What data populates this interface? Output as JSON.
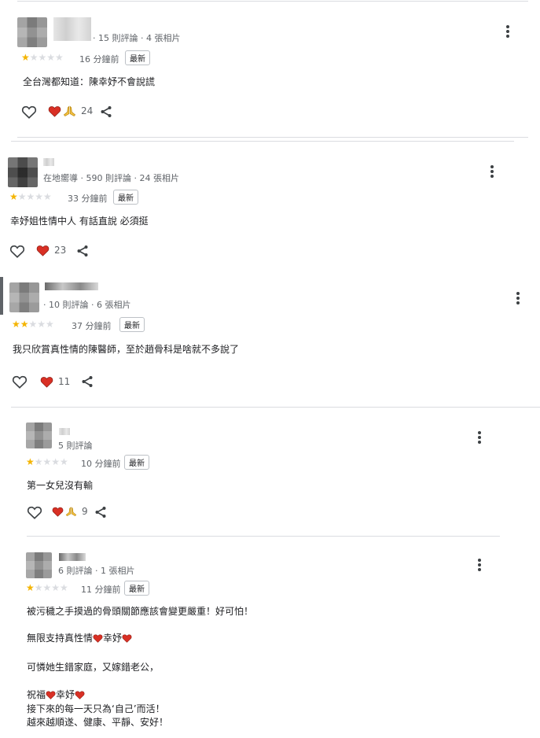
{
  "reviews": [
    {
      "meta": "· 15 則評論 · 4 張相片",
      "rating": 1,
      "time": "16 分鐘前",
      "badge": "最新",
      "lines": [
        "全台灣都知道：陳幸妤不會說謊"
      ],
      "reactions": [
        "heart",
        "pray"
      ],
      "count": "24"
    },
    {
      "meta": "在地嚮導 · 590 則評論 · 24 張相片",
      "rating": 1,
      "time": "33 分鐘前",
      "badge": "最新",
      "lines": [
        "幸妤姐性情中人 有話直說 必須挺"
      ],
      "reactions": [
        "heart"
      ],
      "count": "23"
    },
    {
      "meta": "· 10 則評論 · 6 張相片",
      "rating": 2,
      "time": "37 分鐘前",
      "badge": "最新",
      "lines": [
        "我只欣賞真性情的陳醫師，至於趙骨科是啥就不多說了"
      ],
      "reactions": [
        "heart"
      ],
      "count": "11"
    },
    {
      "meta": "5 則評論",
      "rating": 1,
      "time": "10 分鐘前",
      "badge": "最新",
      "lines": [
        "第一女兒沒有輸"
      ],
      "reactions": [
        "heart",
        "pray"
      ],
      "count": "9"
    },
    {
      "meta": "6 則評論 · 1 張相片",
      "rating": 1,
      "time": "11 分鐘前",
      "badge": "最新",
      "paragraphs": {
        "p1": "被污穢之手摸過的骨頭關節應該會變更嚴重！好可怕！",
        "p2a": "無限支持真性情",
        "p2b": "幸妤",
        "p3": "可憐她生錯家庭，又嫁錯老公，",
        "p4a": "祝福",
        "p4b": "幸妤",
        "p5": "接下來的每一天只為‘自己’而活！",
        "p6": "越來越順遂、健康、平靜、安好！"
      }
    }
  ],
  "colors": {
    "star_on": "#f4b400",
    "star_off": "#dadce0",
    "heart": "#d93025",
    "pray": "#f6c344",
    "divider": "#dadce0"
  },
  "icons": [
    "heart-outline-icon",
    "heart-reaction-icon",
    "pray-reaction-icon",
    "share-icon",
    "more-vert-icon",
    "star-icon"
  ]
}
